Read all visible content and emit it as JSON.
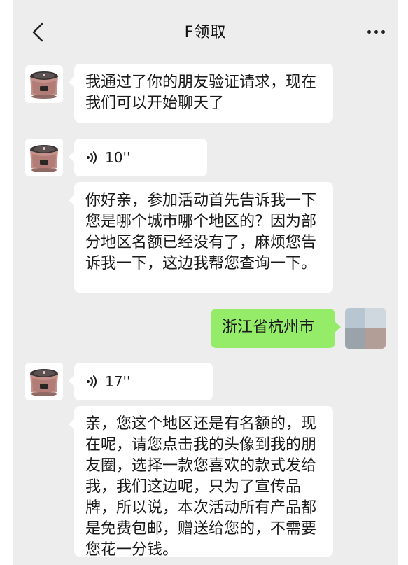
{
  "header": {
    "title": "F领取"
  },
  "messages": [
    {
      "text": "我通过了你的朋友验证请求，现在我们可以开始聊天了"
    },
    {
      "duration": "10''"
    },
    {
      "text": "你好亲，参加活动首先告诉我一下您是哪个城市哪个地区的？因为部分地区名额已经没有了，麻烦您告诉我一下，这边我帮您查询一下。"
    },
    {
      "text": "浙江省杭州市"
    },
    {
      "duration": "17''"
    },
    {
      "text": "亲，您这个地区还是有名额的，现在呢，请您点击我的头像到我的朋友圈，选择一款您喜欢的款式发给我，我们这边呢，只为了宣传品牌，所以说，本次活动所有产品都是免费包邮，赠送给您的，不需要您花一分钱。"
    }
  ],
  "colors": {
    "background": "#ededed",
    "bubble_incoming": "#ffffff",
    "bubble_outgoing": "#95ec69"
  },
  "icons": [
    "chevron-left-icon",
    "more-dots-icon",
    "voice-wave-icon",
    "rice-cooker-avatar"
  ]
}
